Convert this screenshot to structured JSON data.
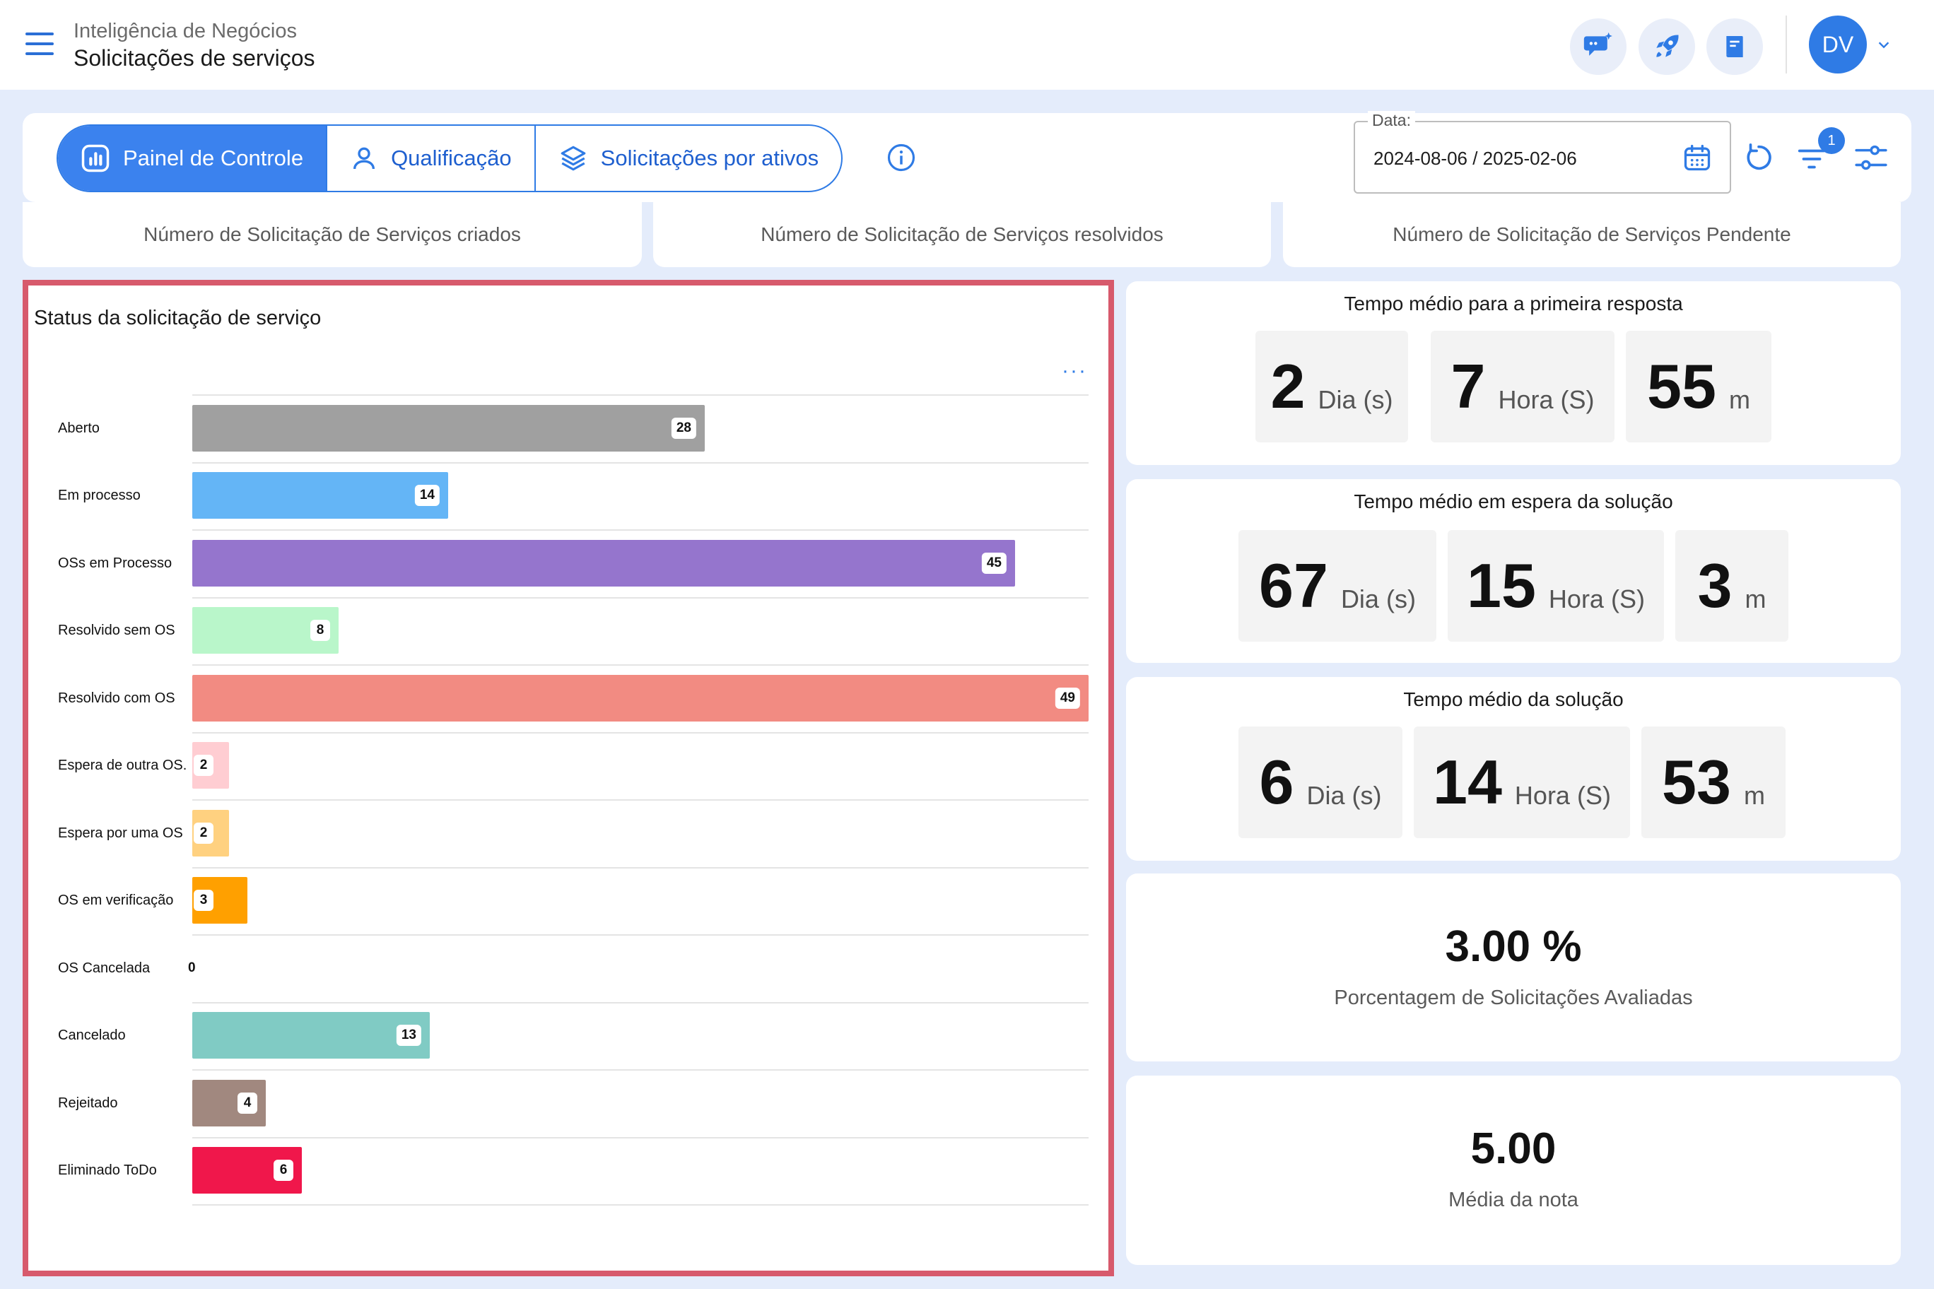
{
  "header": {
    "breadcrumb_parent": "Inteligência de Negócios",
    "page_title": "Solicitações de serviços",
    "user_initials": "DV"
  },
  "tabs": [
    {
      "label": "Painel de Controle",
      "icon": "chart-icon",
      "active": true
    },
    {
      "label": "Qualificação",
      "icon": "user-icon",
      "active": false
    },
    {
      "label": "Solicitações por ativos",
      "icon": "layers-icon",
      "active": false
    }
  ],
  "filters": {
    "date_label": "Data:",
    "date_range": "2024-08-06 / 2025-02-06",
    "filter_badge": "1"
  },
  "counts": [
    {
      "label": "Número de Solicitação de Serviços criados"
    },
    {
      "label": "Número de Solicitação de Serviços resolvidos"
    },
    {
      "label": "Número de Solicitação de Serviços Pendente"
    }
  ],
  "chart_panel": {
    "title": "Status da solicitação de serviço",
    "menu": "···"
  },
  "chart_data": {
    "type": "bar",
    "orientation": "horizontal",
    "title": "Status da solicitação de serviço",
    "categories": [
      "Aberto",
      "Em processo",
      "OSs em Processo",
      "Resolvido sem OS",
      "Resolvido com OS",
      "Espera de outra OS.",
      "Espera por uma OS",
      "OS em verificação",
      "OS Cancelada",
      "Cancelado",
      "Rejeitado",
      "Eliminado ToDo"
    ],
    "values": [
      28,
      14,
      45,
      8,
      49,
      2,
      2,
      3,
      0,
      13,
      4,
      6
    ],
    "colors": [
      "#a0a0a0",
      "#64b5f6",
      "#9575cd",
      "#b9f6ca",
      "#f28b82",
      "#ffcdd2",
      "#ffd180",
      "#ffa000",
      "#cccccc",
      "#80cbc4",
      "#a1887f",
      "#f0174b"
    ],
    "xlim": [
      0,
      49
    ],
    "grid": true,
    "data_labels": true
  },
  "metrics": {
    "first_response": {
      "title": "Tempo médio para a primeira resposta",
      "days": "2",
      "days_unit": "Dia (s)",
      "hours": "7",
      "hours_unit": "Hora (S)",
      "minutes": "55",
      "minutes_unit": "m"
    },
    "waiting": {
      "title": "Tempo médio em espera da solução",
      "days": "67",
      "days_unit": "Dia (s)",
      "hours": "15",
      "hours_unit": "Hora (S)",
      "minutes": "3",
      "minutes_unit": "m"
    },
    "solution": {
      "title": "Tempo médio da solução",
      "days": "6",
      "days_unit": "Dia (s)",
      "hours": "14",
      "hours_unit": "Hora (S)",
      "minutes": "53",
      "minutes_unit": "m"
    },
    "evaluated_percent": {
      "value": "3.00 %",
      "caption": "Porcentagem de Solicitações Avaliadas"
    },
    "average_score": {
      "value": "5.00",
      "caption": "Média da nota"
    }
  }
}
